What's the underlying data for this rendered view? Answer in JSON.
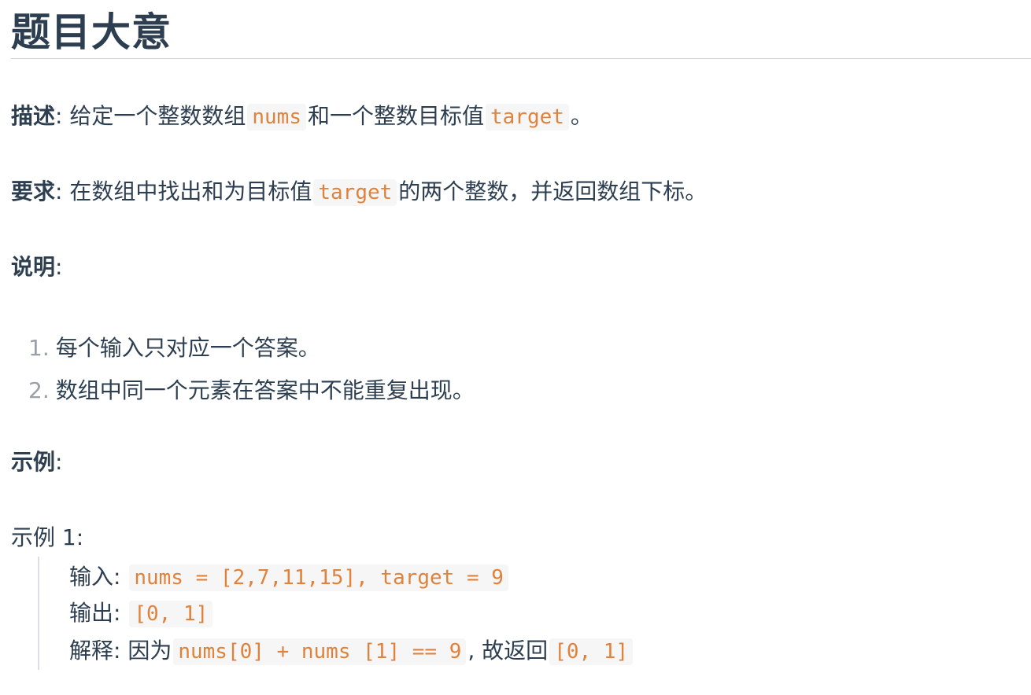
{
  "heading": "题目大意",
  "description": {
    "label": "描述",
    "colon": ":",
    "text_before": " 给定一个整数数组",
    "code_nums": "nums",
    "text_middle": "和一个整数目标值",
    "code_target": "target",
    "text_after": "。"
  },
  "requirement": {
    "label": "要求",
    "colon": ":",
    "text_before": " 在数组中找出和为目标值",
    "code_target": "target",
    "text_after": "的两个整数，并返回数组下标。"
  },
  "notes": {
    "label": "说明",
    "colon": ":",
    "items": [
      {
        "marker": "1.",
        "text": "每个输入只对应一个答案。"
      },
      {
        "marker": "2.",
        "text": "数组中同一个元素在答案中不能重复出现。"
      }
    ]
  },
  "examples_heading": {
    "label": "示例",
    "colon": ":"
  },
  "example1": {
    "title": "示例 1:",
    "input_label": "输入:",
    "input_code": "nums = [2,7,11,15], target = 9",
    "output_label": "输出:",
    "output_code": "[0, 1]",
    "explain_label": "解释:",
    "explain_text_before": " 因为",
    "explain_code1": "nums[0] + nums [1] == 9",
    "explain_text_middle": ", 故返回",
    "explain_code2": "[0, 1]"
  },
  "colors": {
    "text": "#2c3e50",
    "code_text": "#e0823b",
    "code_bg": "#f6f6f6",
    "list_marker": "#9aa0a6",
    "rule": "#d0d4d9"
  }
}
